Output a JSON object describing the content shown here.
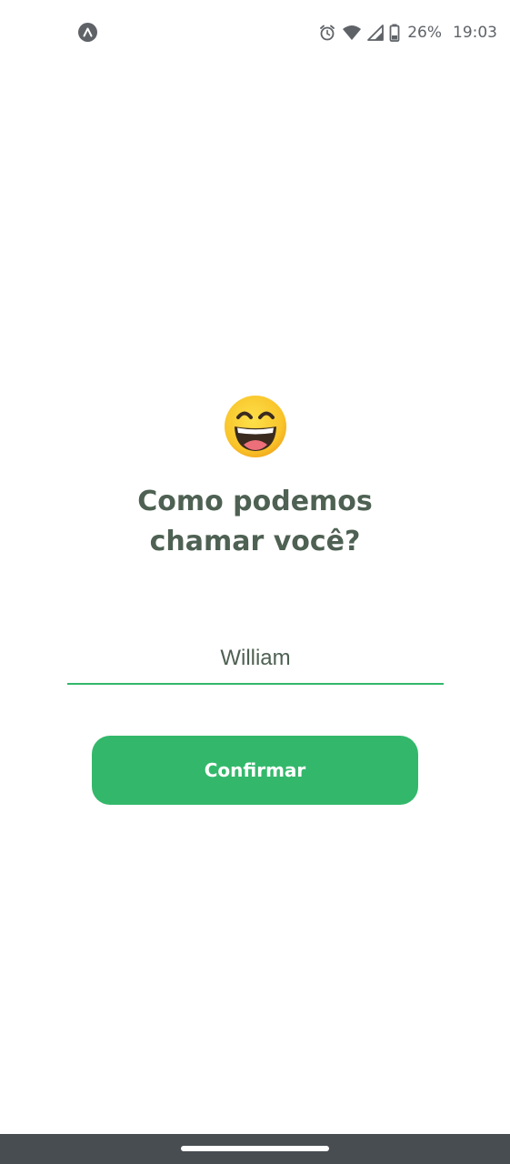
{
  "status_bar": {
    "left_icon": "expo-app-icon",
    "icons": [
      "alarm-icon",
      "wifi-icon",
      "signal-icon",
      "battery-icon"
    ],
    "battery_percent": "26%",
    "time": "19:03"
  },
  "main": {
    "emoji_icon": "grinning-face-with-smiling-eyes",
    "title_line1": "Como podemos",
    "title_line2": "chamar você?",
    "name_input": {
      "value": "William"
    },
    "confirm_label": "Confirmar"
  },
  "colors": {
    "accent": "#33b86b",
    "title_text": "#4e6153",
    "nav_bar": "#484d52",
    "status_icons": "#5f6368"
  },
  "nav_bar": {
    "home_handle": "home-gesture-handle"
  }
}
